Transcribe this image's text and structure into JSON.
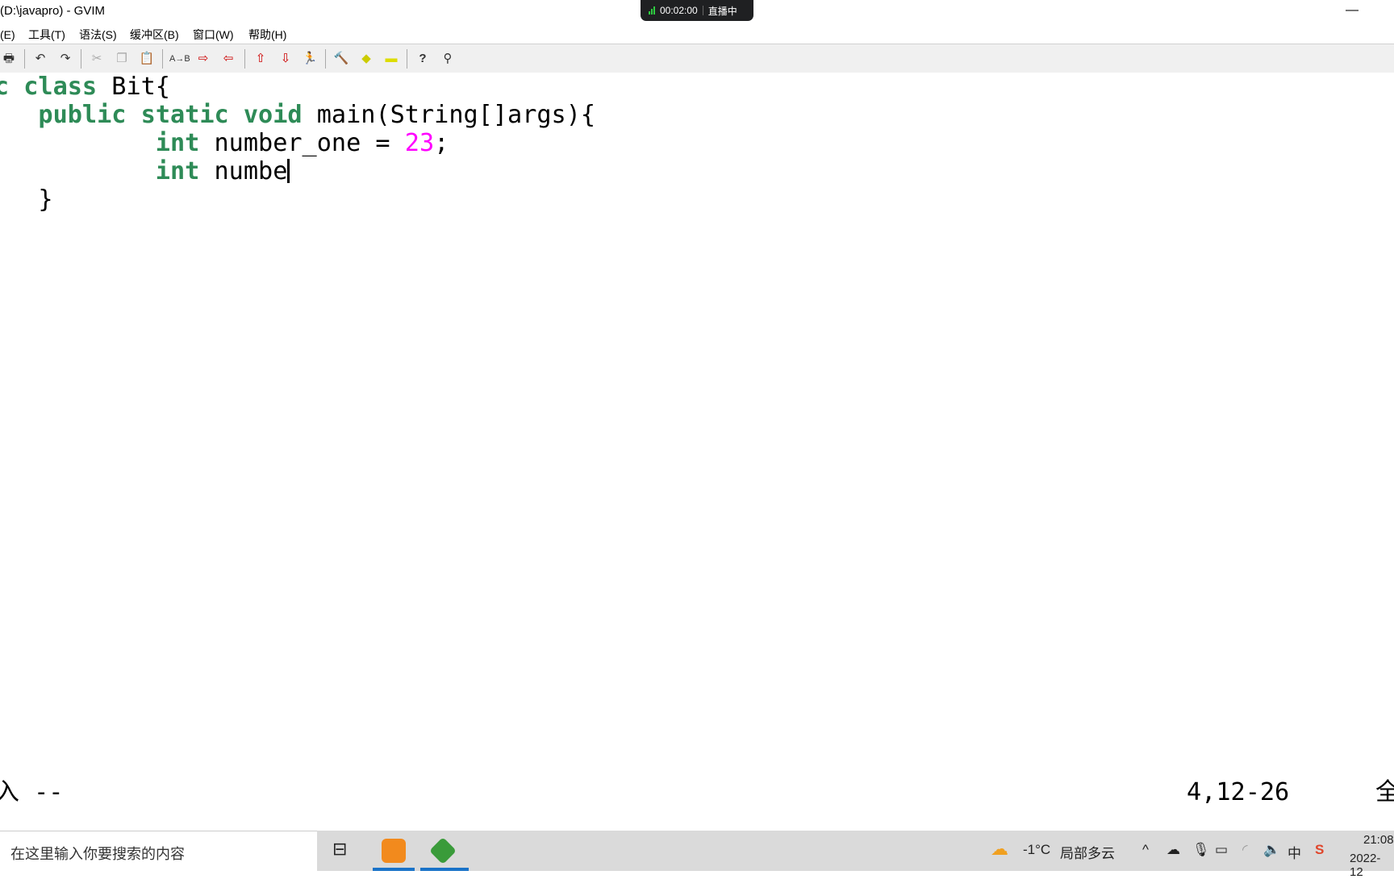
{
  "window": {
    "title": "(D:\\javapro) - GVIM",
    "minimize_icon": "minimize-icon"
  },
  "recording": {
    "time": "00:02:00",
    "status": "直播中"
  },
  "menu": [
    "编(E)",
    "工具(T)",
    "语法(S)",
    "缓冲区(B)",
    "窗口(W)",
    "帮助(H)"
  ],
  "toolbar": [
    "print-icon",
    "undo-icon",
    "redo-icon",
    "cut-icon",
    "copy-icon",
    "paste-icon",
    "replace-icon",
    "find-next-icon",
    "find-prev-icon",
    "load-session-icon",
    "save-session-icon",
    "run-script-icon",
    "make-icon",
    "tag-jump-icon",
    "tag-icon",
    "help-icon",
    "find-help-icon"
  ],
  "code": {
    "line1": {
      "kw1": "public",
      "sp": " ",
      "kw2": "class",
      "rest": " Bit{"
    },
    "line2": {
      "tab": "\t",
      "kw1": "public",
      "kw2": "static",
      "kw3": "void",
      "rest": " main(String[]args){"
    },
    "line3": {
      "tab": "\t\t",
      "kw": "int",
      "rest": " number_one = ",
      "num": "23",
      "end": ";"
    },
    "line4": {
      "tab": "\t\t",
      "kw": "int",
      "rest": " numbe"
    },
    "line5": {
      "text": "\t}"
    }
  },
  "statusline": {
    "mode": "-- 插入 --",
    "position": "4,12-26",
    "scroll": "全部"
  },
  "taskbar": {
    "search_placeholder": "在这里输入你要搜索的内容",
    "weather_temp": "-1°C",
    "weather_desc": "局部多云",
    "ime": "中",
    "time": "21:08",
    "date": "2022-12"
  }
}
